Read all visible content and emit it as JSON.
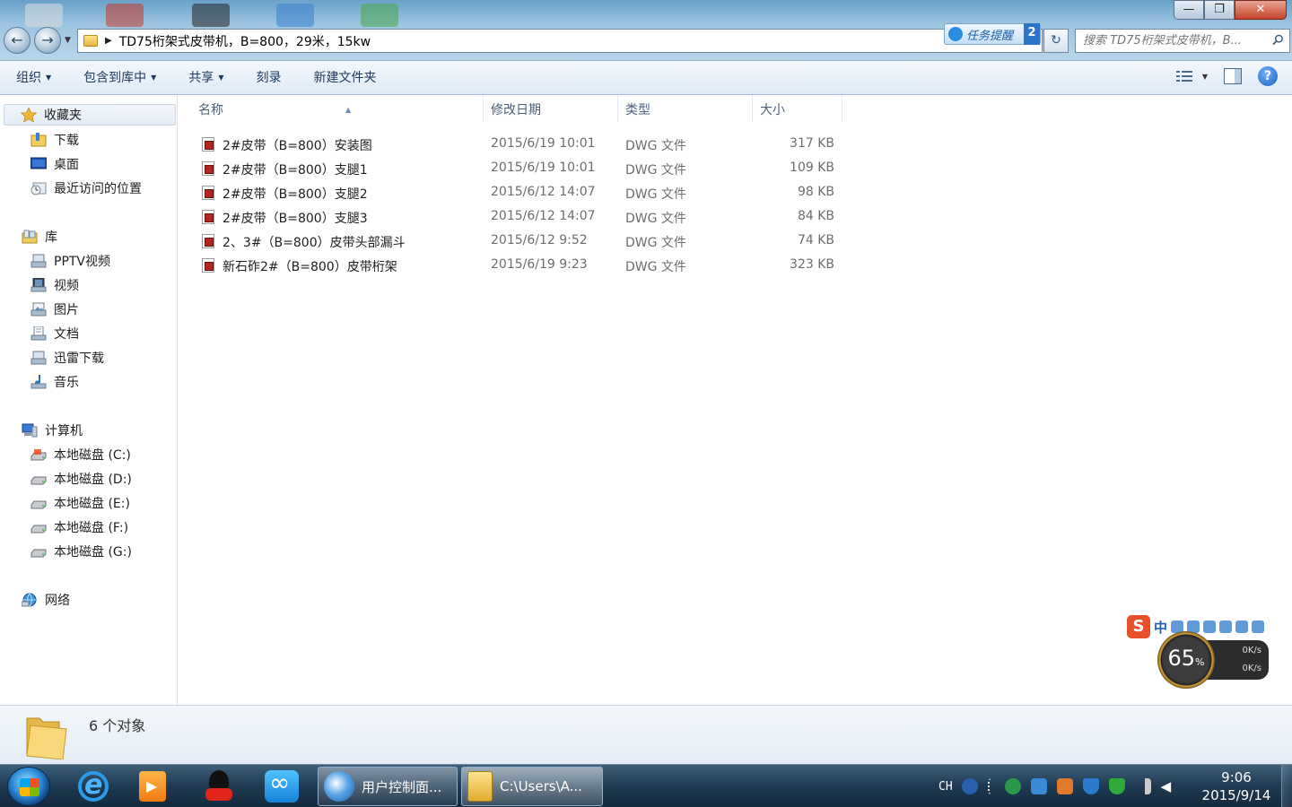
{
  "window": {
    "address": "TD75桁架式皮带机，B=800，29米，15kw",
    "search_placeholder": "搜索 TD75桁架式皮带机，B...",
    "task_reminder_label": "任务提醒",
    "task_reminder_count": "2",
    "controls": {
      "minimize": "—",
      "maximize": "❐",
      "close": "✕"
    }
  },
  "toolbar": {
    "organize": "组织",
    "include_in_library": "包含到库中",
    "share": "共享",
    "burn": "刻录",
    "new_folder": "新建文件夹"
  },
  "nav": {
    "favorites": "收藏夹",
    "downloads": "下载",
    "desktop": "桌面",
    "recent_places": "最近访问的位置",
    "libraries": "库",
    "pptv": "PPTV视频",
    "videos": "视频",
    "pictures": "图片",
    "documents": "文档",
    "thunder_downloads": "迅雷下载",
    "music": "音乐",
    "computer": "计算机",
    "drive_c": "本地磁盘 (C:)",
    "drive_d": "本地磁盘 (D:)",
    "drive_e": "本地磁盘 (E:)",
    "drive_f": "本地磁盘 (F:)",
    "drive_g": "本地磁盘 (G:)",
    "network": "网络"
  },
  "columns": {
    "name": "名称",
    "date": "修改日期",
    "type": "类型",
    "size": "大小"
  },
  "files": [
    {
      "name": "2#皮带（B=800）安装图",
      "date": "2015/6/19 10:01",
      "type": "DWG 文件",
      "size": "317 KB"
    },
    {
      "name": "2#皮带（B=800）支腿1",
      "date": "2015/6/19 10:01",
      "type": "DWG 文件",
      "size": "109 KB"
    },
    {
      "name": "2#皮带（B=800）支腿2",
      "date": "2015/6/12 14:07",
      "type": "DWG 文件",
      "size": "98 KB"
    },
    {
      "name": "2#皮带（B=800）支腿3",
      "date": "2015/6/12 14:07",
      "type": "DWG 文件",
      "size": "84 KB"
    },
    {
      "name": "2、3#（B=800）皮带头部漏斗",
      "date": "2015/6/12 9:52",
      "type": "DWG 文件",
      "size": "74 KB"
    },
    {
      "name": "新石砟2#（B=800）皮带桁架",
      "date": "2015/6/19 9:23",
      "type": "DWG 文件",
      "size": "323 KB"
    }
  ],
  "details": {
    "count": "6 个对象"
  },
  "widgets": {
    "ime_s": "S",
    "ime_lang": "中",
    "speed_percent": "65",
    "speed_unit": "%",
    "upload": "0K/s",
    "download": "0K/s"
  },
  "taskbar": {
    "window1_label": "用户控制面...",
    "window2_label": "C:\\Users\\A...",
    "lang": "CH",
    "time": "9:06",
    "date": "2015/9/14"
  }
}
